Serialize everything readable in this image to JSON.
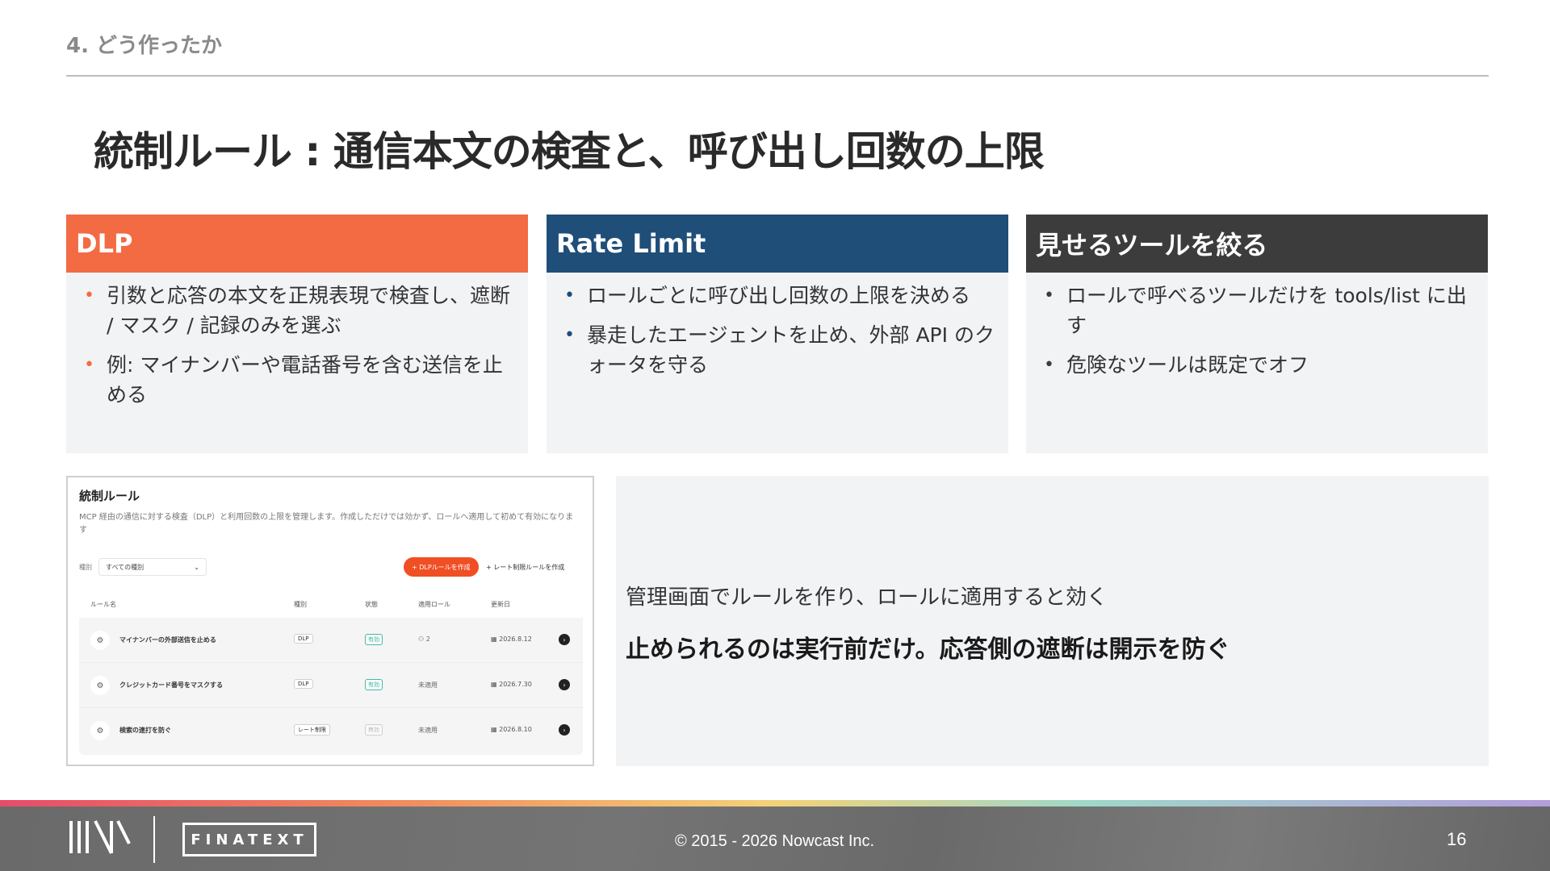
{
  "section_label": "4. どう作ったか",
  "title": "統制ルール : 通信本文の検査と、呼び出し回数の上限",
  "cards": [
    {
      "heading": "DLP",
      "bullets": [
        "引数と応答の本文を正規表現で検査し、遮断 / マスク / 記録のみを選ぶ",
        "例: マイナンバーや電話番号を含む送信を止める"
      ]
    },
    {
      "heading": "Rate Limit",
      "bullets": [
        "ロールごとに呼び出し回数の上限を決める",
        "暴走したエージェントを止め、外部 API のクォータを守る"
      ]
    },
    {
      "heading": "見せるツールを絞る",
      "bullets": [
        "ロールで呼べるツールだけを tools/list に出す",
        "危険なツールは既定でオフ"
      ]
    }
  ],
  "screenshot": {
    "title": "統制ルール",
    "description": "MCP 経由の通信に対する検査（DLP）と利用回数の上限を管理します。作成しただけでは効かず、ロールへ適用して初めて有効になります",
    "filter_label": "種別",
    "filter_value": "すべての種別",
    "btn_dlp": "+ DLPルールを作成",
    "btn_rate": "+ レート制限ルールを作成",
    "columns": [
      "ルール名",
      "種別",
      "状態",
      "適用ロール",
      "更新日"
    ],
    "rows": [
      {
        "name": "マイナンバーの外部送信を止める",
        "type": "DLP",
        "status": "有効",
        "roles": "2",
        "date": "2026.8.12"
      },
      {
        "name": "クレジットカード番号をマスクする",
        "type": "DLP",
        "status": "有効",
        "roles": "未適用",
        "date": "2026.7.30"
      },
      {
        "name": "検索の連打を防ぐ",
        "type": "レート制限",
        "status": "無効",
        "roles": "未適用",
        "date": "2026.8.10"
      }
    ]
  },
  "note": {
    "line1": "管理画面でルールを作り、ロールに適用すると効く",
    "line2": "止められるのは実行前だけ。応答側の遮断は開示を防ぐ"
  },
  "footer": {
    "logo_text": "FINATEXT",
    "copyright": "© 2015 - 2026 Nowcast Inc.",
    "page_number": "16"
  },
  "colors": {
    "dlp": "#f26b43",
    "rate_limit": "#1f4e79",
    "tools": "#3c3c3c"
  }
}
